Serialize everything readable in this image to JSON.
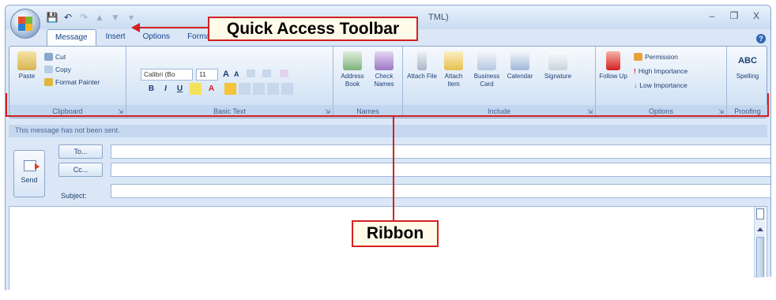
{
  "window": {
    "title_fragment": "TML)",
    "controls": [
      "–",
      "❐",
      "X"
    ]
  },
  "qat": {
    "items": [
      "save-icon",
      "undo-icon",
      "redo-icon",
      "previous-icon",
      "next-icon",
      "customize-icon"
    ]
  },
  "tabs": [
    {
      "label": "Message",
      "active": true
    },
    {
      "label": "Insert",
      "active": false
    },
    {
      "label": "Options",
      "active": false
    },
    {
      "label": "Format Text",
      "active": false
    }
  ],
  "ribbon": {
    "clipboard": {
      "label": "Clipboard",
      "paste": "Paste",
      "cut": "Cut",
      "copy": "Copy",
      "format_painter": "Format Painter"
    },
    "basic_text": {
      "label": "Basic Text",
      "font": "Calibri (Bo",
      "size": "11",
      "bold": "B",
      "italic": "I",
      "underline": "U"
    },
    "names": {
      "label": "Names",
      "address_book": "Address Book",
      "check_names": "Check Names"
    },
    "include": {
      "label": "Include",
      "attach_file": "Attach File",
      "attach_item": "Attach Item",
      "business_card": "Business Card",
      "calendar": "Calendar",
      "signature": "Signature"
    },
    "options": {
      "label": "Options",
      "follow_up": "Follow Up",
      "permission": "Permission",
      "high_importance": "High Importance",
      "low_importance": "Low Importance"
    },
    "proofing": {
      "label": "Proofing",
      "spelling": "Spelling",
      "abc": "ABC"
    }
  },
  "message": {
    "info": "This message has not been sent.",
    "send": "Send",
    "to": "To...",
    "cc": "Cc...",
    "subject_label": "Subject:"
  },
  "annotations": {
    "qat_label": "Quick Access Toolbar",
    "ribbon_label": "Ribbon"
  },
  "colors": {
    "callout_border": "#d32020",
    "callout_fill": "#fffbe8",
    "ribbon_blue": "#dbe8f7"
  }
}
